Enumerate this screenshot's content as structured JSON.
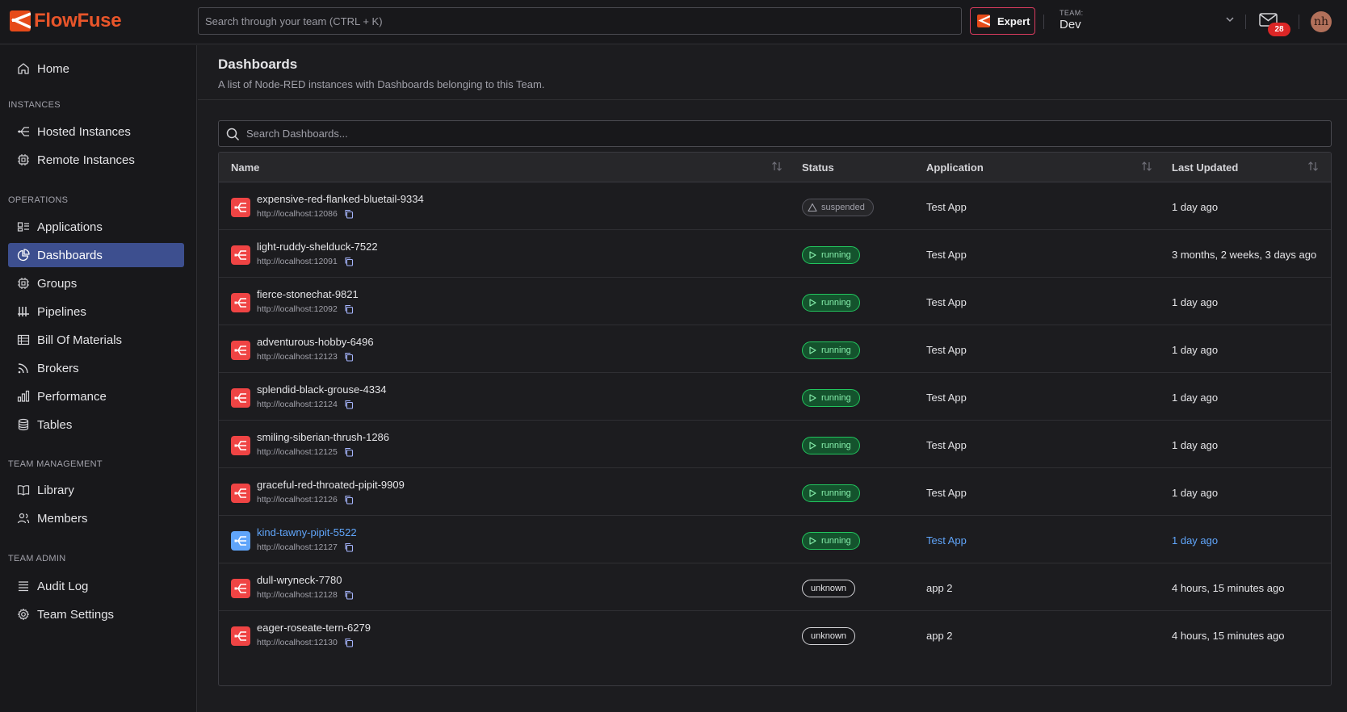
{
  "brand": {
    "name": "FlowFuse"
  },
  "header": {
    "search_placeholder": "Search through your team (CTRL + K)",
    "expert_label": "Expert",
    "team_label": "TEAM:",
    "team_name": "Dev",
    "notification_count": "28",
    "avatar_initials": "nh"
  },
  "sidebar": {
    "home": "Home",
    "sections": {
      "instances": "INSTANCES",
      "operations": "OPERATIONS",
      "team_management": "TEAM MANAGEMENT",
      "team_admin": "TEAM ADMIN"
    },
    "items": {
      "hosted": "Hosted Instances",
      "remote": "Remote Instances",
      "applications": "Applications",
      "dashboards": "Dashboards",
      "groups": "Groups",
      "pipelines": "Pipelines",
      "bom": "Bill Of Materials",
      "brokers": "Brokers",
      "performance": "Performance",
      "tables": "Tables",
      "library": "Library",
      "members": "Members",
      "audit": "Audit Log",
      "settings": "Team Settings"
    }
  },
  "page": {
    "title": "Dashboards",
    "description": "A list of Node-RED instances with Dashboards belonging to this Team.",
    "search_placeholder": "Search Dashboards..."
  },
  "table": {
    "columns": {
      "name": "Name",
      "status": "Status",
      "application": "Application",
      "updated": "Last Updated"
    },
    "rows": [
      {
        "name": "expensive-red-flanked-bluetail-9334",
        "url": "http://localhost:12086",
        "status": "suspended",
        "app": "Test App",
        "updated": "1 day ago"
      },
      {
        "name": "light-ruddy-shelduck-7522",
        "url": "http://localhost:12091",
        "status": "running",
        "app": "Test App",
        "updated": "3 months, 2 weeks, 3 days ago"
      },
      {
        "name": "fierce-stonechat-9821",
        "url": "http://localhost:12092",
        "status": "running",
        "app": "Test App",
        "updated": "1 day ago"
      },
      {
        "name": "adventurous-hobby-6496",
        "url": "http://localhost:12123",
        "status": "running",
        "app": "Test App",
        "updated": "1 day ago"
      },
      {
        "name": "splendid-black-grouse-4334",
        "url": "http://localhost:12124",
        "status": "running",
        "app": "Test App",
        "updated": "1 day ago"
      },
      {
        "name": "smiling-siberian-thrush-1286",
        "url": "http://localhost:12125",
        "status": "running",
        "app": "Test App",
        "updated": "1 day ago"
      },
      {
        "name": "graceful-red-throated-pipit-9909",
        "url": "http://localhost:12126",
        "status": "running",
        "app": "Test App",
        "updated": "1 day ago"
      },
      {
        "name": "kind-tawny-pipit-5522",
        "url": "http://localhost:12127",
        "status": "running",
        "app": "Test App",
        "updated": "1 day ago"
      },
      {
        "name": "dull-wryneck-7780",
        "url": "http://localhost:12128",
        "status": "unknown",
        "app": "app 2",
        "updated": "4 hours, 15 minutes ago"
      },
      {
        "name": "eager-roseate-tern-6279",
        "url": "http://localhost:12130",
        "status": "unknown",
        "app": "app 2",
        "updated": "4 hours, 15 minutes ago"
      }
    ]
  },
  "colors": {
    "accent": "#e8552a",
    "active_nav": "#3d4f8f",
    "running": "#22c55e",
    "instance_icon": "#ef4444",
    "highlight": "#60a5fa"
  }
}
